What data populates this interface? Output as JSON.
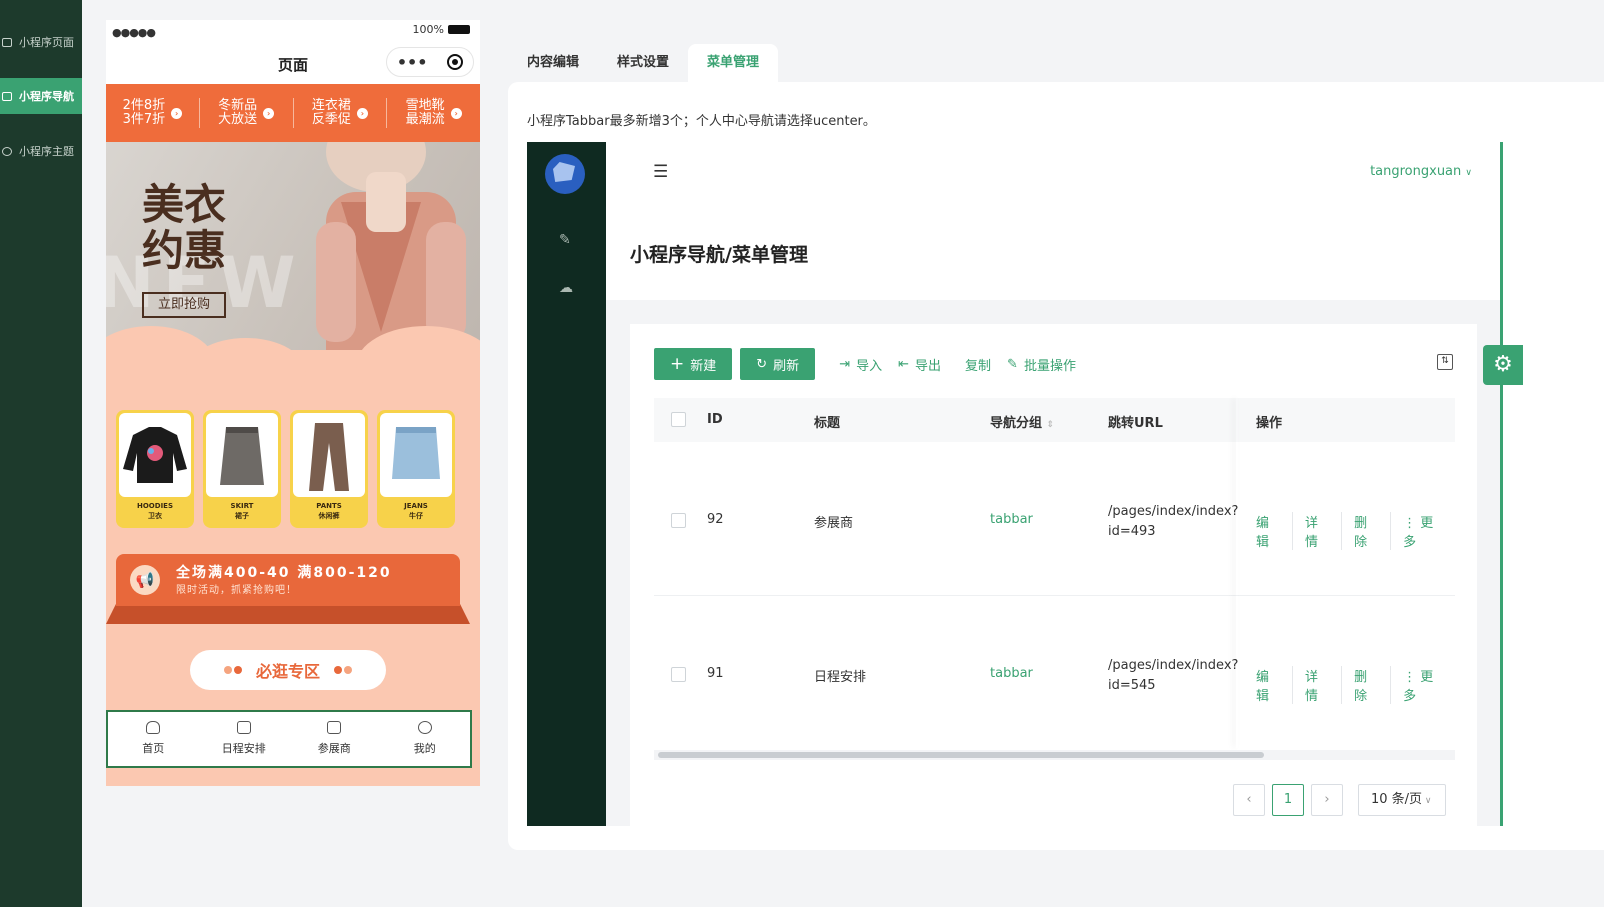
{
  "sidebar": {
    "items": [
      {
        "label": "小程序页面"
      },
      {
        "label": "小程序导航"
      },
      {
        "label": "小程序主题"
      }
    ]
  },
  "phone": {
    "status_dots": "●●●●●",
    "battery": "100%",
    "title": "页面",
    "capsule_more": "•••",
    "promos": [
      {
        "l1": "2件8折",
        "l2": "3件7折"
      },
      {
        "l1": "冬新品",
        "l2": "大放送"
      },
      {
        "l1": "连衣裙",
        "l2": "反季促"
      },
      {
        "l1": "雪地靴",
        "l2": "最潮流"
      }
    ],
    "hero": {
      "title1": "美衣",
      "title2": "约惠",
      "button": "立即抢购",
      "watermark": "NEW"
    },
    "categories": [
      {
        "en": "HOODIES",
        "cn": "卫衣"
      },
      {
        "en": "SKIRT",
        "cn": "裙子"
      },
      {
        "en": "PANTS",
        "cn": "休闲裤"
      },
      {
        "en": "JEANS",
        "cn": "牛仔"
      }
    ],
    "sale": {
      "line1": "全场满400-40 满800-120",
      "line2": "限时活动，抓紧抢购吧！"
    },
    "must": "必逛专区",
    "tabbar": [
      {
        "label": "首页"
      },
      {
        "label": "日程安排"
      },
      {
        "label": "参展商"
      },
      {
        "label": "我的"
      }
    ]
  },
  "tabs": [
    {
      "label": "内容编辑"
    },
    {
      "label": "样式设置"
    },
    {
      "label": "菜单管理"
    }
  ],
  "hint": "小程序Tabbar最多新增3个；个人中心导航请选择ucenter。",
  "admin": {
    "user": "tangrongxuan",
    "page_title": "小程序导航/菜单管理",
    "toolbar": {
      "new": "新建",
      "refresh": "刷新",
      "import": "导入",
      "export": "导出",
      "copy": "复制",
      "batch": "批量操作"
    },
    "columns": {
      "id": "ID",
      "title": "标题",
      "group": "导航分组",
      "url": "跳转URL",
      "ops": "操作"
    },
    "rows": [
      {
        "id": "92",
        "title": "参展商",
        "group": "tabbar",
        "url1": "/pages/index/index?",
        "url2": "id=493"
      },
      {
        "id": "91",
        "title": "日程安排",
        "group": "tabbar",
        "url1": "/pages/index/index?",
        "url2": "id=545"
      }
    ],
    "ops": {
      "edit": "编辑",
      "detail": "详情",
      "delete": "删除",
      "more": "更多"
    },
    "pager": {
      "prev": "‹",
      "page": "1",
      "next": "›",
      "size": "10 条/页"
    }
  },
  "colors": {
    "accent": "#3aa272",
    "sidebar_bg": "#1d3a2c",
    "admin_aside": "#0f2a21",
    "promo": "#ef6c3b"
  }
}
